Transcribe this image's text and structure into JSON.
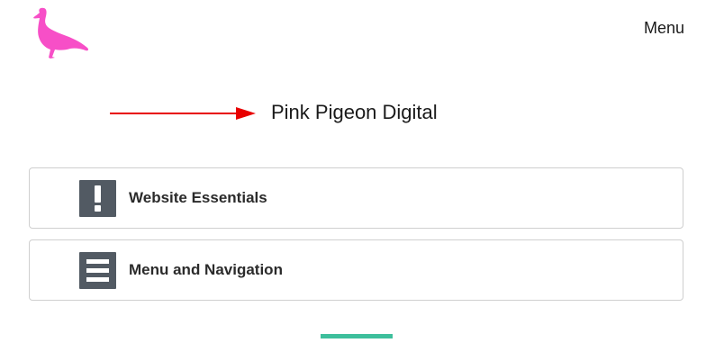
{
  "header": {
    "logo_icon": "pigeon-icon",
    "logo_color": "#f74fc7",
    "menu_label": "Menu"
  },
  "hero": {
    "arrow_icon": "arrow-right-icon",
    "arrow_color": "#e80000",
    "site_title": "Pink Pigeon Digital"
  },
  "cards": [
    {
      "icon": "exclamation-icon",
      "label": "Website Essentials"
    },
    {
      "icon": "menu-lines-icon",
      "label": "Menu and Navigation"
    }
  ],
  "colors": {
    "icon_box": "#525a63",
    "accent_bar": "#3dbf9c"
  }
}
